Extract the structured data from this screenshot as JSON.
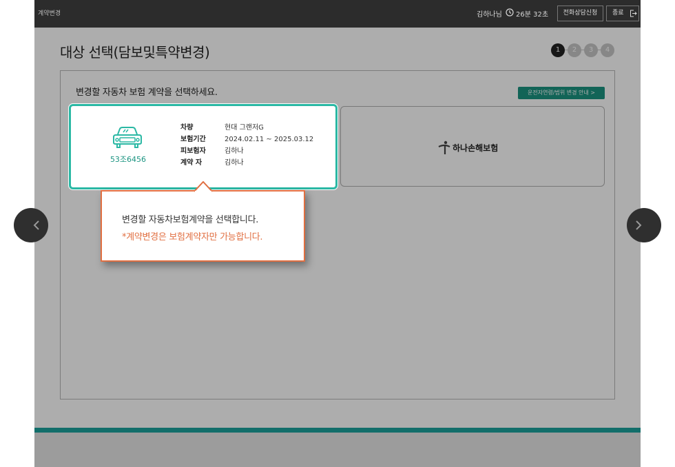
{
  "header": {
    "title": "계약변경",
    "user_name": "김하나님",
    "timer": "26분 32초",
    "consult_button": "전화상담신청",
    "exit_button": "종료"
  },
  "page": {
    "title": "대상 선택(담보및특약변경)",
    "steps": [
      "1",
      "2",
      "3",
      "4"
    ],
    "current_step": 1
  },
  "panel": {
    "instruction": "변경할 자동차 보험 계약을 선택하세요.",
    "guide_button": "운전자연령/범위 변경 안내 >"
  },
  "contract_card": {
    "plate": "53조6456",
    "rows": [
      {
        "label": "차량",
        "value": "현대 그랜저G"
      },
      {
        "label": "보험기간",
        "value": "2024.02.11 ~ 2025.03.12"
      },
      {
        "label": "피보험자",
        "value": "김하나"
      },
      {
        "label": "계약 자",
        "value": "김하나"
      }
    ]
  },
  "company_card": {
    "logo_text": "하나손해보험"
  },
  "tooltip": {
    "line1": "변경할 자동차보험계약을 선택합니다.",
    "line2": "*계약변경은 보험계약자만 가능합니다."
  },
  "colors": {
    "accent": "#2ab8a4",
    "brand": "#1b9481",
    "warning": "#e16f41",
    "header_bg": "#2c2c2c",
    "bottom_bar": "#126e6a"
  },
  "icons": {
    "clock": "clock-icon",
    "exit": "logout-icon",
    "car": "car-icon",
    "logo": "hana-logo-icon",
    "prev": "chevron-left-icon",
    "next": "chevron-right-icon"
  }
}
